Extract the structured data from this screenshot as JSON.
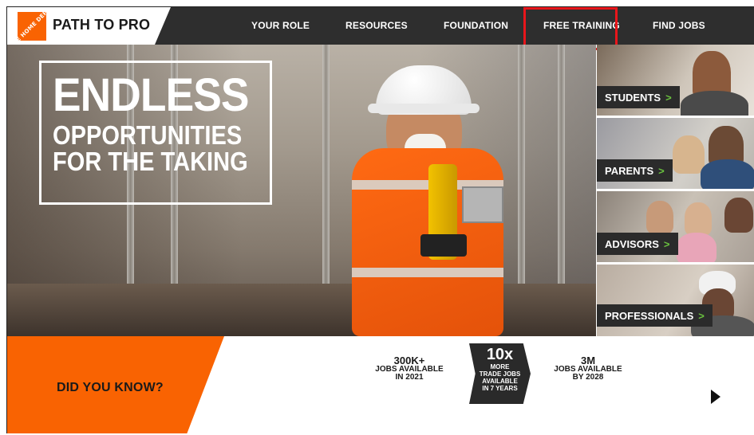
{
  "brand": {
    "logo_text": "THE HOME DEPOT",
    "name": "PATH TO PRO"
  },
  "nav": {
    "items": [
      "YOUR ROLE",
      "RESOURCES",
      "FOUNDATION",
      "FREE TRAINING",
      "FIND JOBS"
    ],
    "highlighted": "FREE TRAINING"
  },
  "hero": {
    "line1": "ENDLESS",
    "line2": "OPPORTUNITIES",
    "line3": "FOR THE TAKING"
  },
  "audiences": [
    {
      "label": "STUDENTS",
      "arrow": ">"
    },
    {
      "label": "PARENTS",
      "arrow": ">"
    },
    {
      "label": "ADVISORS",
      "arrow": ">"
    },
    {
      "label": "PROFESSIONALS",
      "arrow": ">"
    }
  ],
  "did_you_know": "DID YOU KNOW?",
  "stats": {
    "s1": {
      "big": "300K+",
      "l1": "JOBS AVAILABLE",
      "l2": "IN 2021"
    },
    "s2": {
      "big": "10x",
      "l1": "MORE",
      "l2": "TRADE JOBS",
      "l3": "AVAILABLE",
      "l4": "IN 7 YEARS"
    },
    "s3": {
      "big": "3M",
      "l1": "JOBS AVAILABLE",
      "l2": "BY 2028"
    }
  },
  "colors": {
    "brand_orange": "#f96302",
    "nav_bg": "#2e2e2e",
    "highlight_red": "#e8161b",
    "arrow_green": "#6ac13f"
  },
  "icons": {
    "next": "play-triangle-icon"
  }
}
